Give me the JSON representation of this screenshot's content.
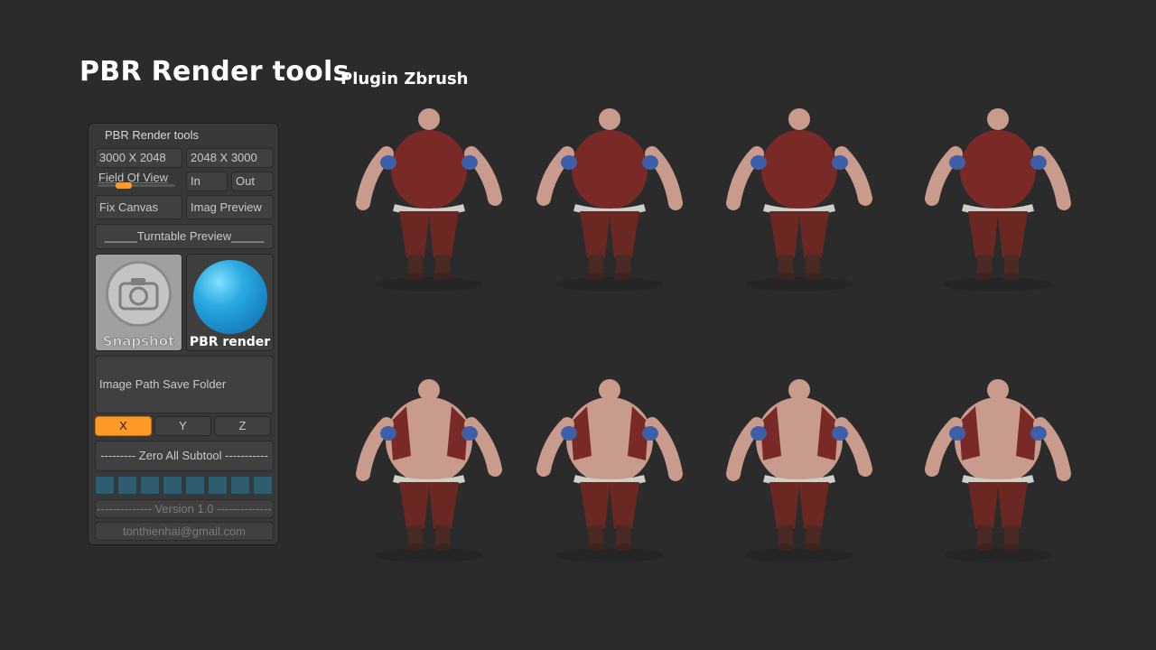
{
  "header": {
    "title": "PBR Render tools",
    "subtitle": "Plugin Zbrush"
  },
  "panel": {
    "title": "PBR Render tools",
    "res_a": "3000 X 2048",
    "res_b": "2048 X 3000",
    "fov_label": "Field Of View",
    "fov_value": 0.3,
    "in_label": "In",
    "out_label": "Out",
    "fix_canvas": "Fix Canvas",
    "imag_preview": "Imag Preview",
    "turntable": "_____Turntable Preview_____",
    "snapshot": "Snapshot",
    "pbr_render": "PBR render",
    "image_path": "Image Path Save Folder",
    "axis": [
      "X",
      "Y",
      "Z"
    ],
    "active_axis": "X",
    "zero_all": "--------- Zero All Subtool -----------",
    "version": "-------------- Version 1.0 --------------",
    "email": "tonthienhai@gmail.com",
    "accent_color": "#ff9a26",
    "swatch_color": "#2f5d70"
  },
  "renders": {
    "subject": "sumo-character",
    "colors": {
      "vest": "#7a2a26",
      "pants": "#6b2823",
      "skin": "#c99b8c",
      "tattoo": "#3d5fa8",
      "rope": "#cfcfc9"
    }
  }
}
